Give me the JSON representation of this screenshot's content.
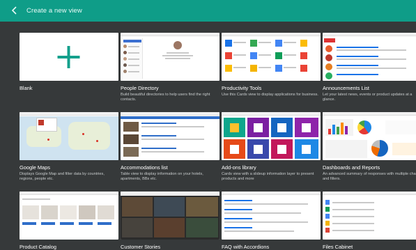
{
  "header": {
    "title": "Create a new view",
    "accent": "#0f9d88"
  },
  "cards": [
    {
      "key": "blank",
      "name": "Blank",
      "desc": ""
    },
    {
      "key": "people",
      "name": "People Directory",
      "desc": "Build beautiful directories to help users find the right contacts."
    },
    {
      "key": "productivity",
      "name": "Productivity Tools",
      "desc": "Use this Cards view to display applications for business."
    },
    {
      "key": "announcements",
      "name": "Announcements List",
      "desc": "Let your latest news, events or product updates at a glance."
    },
    {
      "key": "maps",
      "name": "Google Maps",
      "desc": "Displays Google Map and filter data by countries, regions, people etc."
    },
    {
      "key": "accommodations",
      "name": "Accommodations list",
      "desc": "Table view to display information on your hotels, apartments, BBs etc."
    },
    {
      "key": "addons",
      "name": "Add-ons library",
      "desc": "Cards view with a slideup information layer to present products and more"
    },
    {
      "key": "dashboards",
      "name": "Dashboards and Reports",
      "desc": "An advanced summary of responses with multiple charts and filters."
    },
    {
      "key": "catalog",
      "name": "Product Catalog",
      "desc": ""
    },
    {
      "key": "stories",
      "name": "Customer Stories",
      "desc": ""
    },
    {
      "key": "faq",
      "name": "FAQ with Accordions",
      "desc": ""
    },
    {
      "key": "files",
      "name": "Files Cabinet",
      "desc": ""
    }
  ]
}
